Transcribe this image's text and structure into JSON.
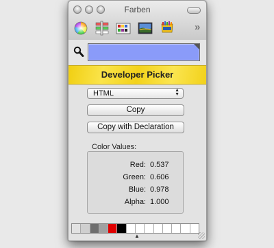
{
  "window": {
    "title": "Farben"
  },
  "toolbar": {
    "tools": [
      {
        "icon": "color-wheel-icon"
      },
      {
        "icon": "color-sliders-icon"
      },
      {
        "icon": "color-palettes-icon"
      },
      {
        "icon": "image-palettes-icon"
      },
      {
        "icon": "crayons-icon"
      }
    ],
    "overflow": "»"
  },
  "current_color": {
    "hex": "#8a9bf9"
  },
  "picker": {
    "title": "Developer Picker",
    "format": "HTML",
    "copy_label": "Copy",
    "copy_decl_label": "Copy with Declaration"
  },
  "values": {
    "title": "Color Values:",
    "rows": [
      {
        "label": "Red:",
        "value": "0.537"
      },
      {
        "label": "Green:",
        "value": "0.606"
      },
      {
        "label": "Blue:",
        "value": "0.978"
      },
      {
        "label": "Alpha:",
        "value": "1.000"
      }
    ]
  },
  "palette": {
    "swatches": [
      "#e2e2e2",
      "#cfcfcf",
      "#6e6e6e",
      "#a0a0a0",
      "#e00000",
      "#000000",
      "#ffffff",
      "#ffffff",
      "#ffffff",
      "#ffffff",
      "#ffffff",
      "#ffffff",
      "#ffffff",
      "#ffffff"
    ]
  }
}
